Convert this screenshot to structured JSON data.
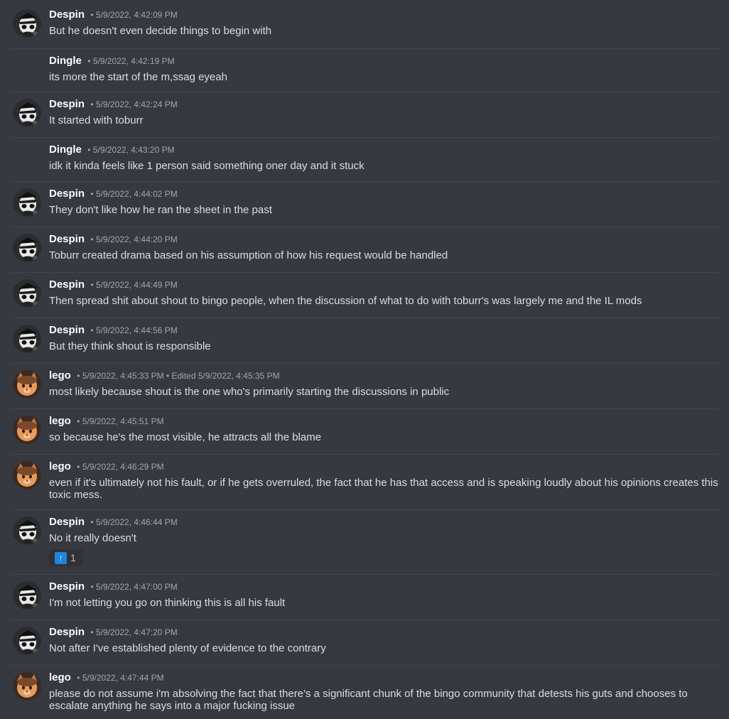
{
  "separator": "•",
  "edited_prefix": "Edited",
  "messages": [
    {
      "author": "Despin",
      "timestamp": "5/9/2022, 4:42:09 PM",
      "text": "But he doesn't even decide things to begin with",
      "avatar": "despin-avatar"
    },
    {
      "author": "Dingle",
      "timestamp": "5/9/2022, 4:42:19 PM",
      "text": "its more the start of the m,ssag eyeah"
    },
    {
      "author": "Despin",
      "timestamp": "5/9/2022, 4:42:24 PM",
      "text": "It started with toburr",
      "avatar": "despin-avatar"
    },
    {
      "author": "Dingle",
      "timestamp": "5/9/2022, 4:43:20 PM",
      "text": "idk it kinda feels like 1 person said something oner day and it stuck"
    },
    {
      "author": "Despin",
      "timestamp": "5/9/2022, 4:44:02 PM",
      "text": "They don't like how he ran the sheet in the past",
      "avatar": "despin-avatar"
    },
    {
      "author": "Despin",
      "timestamp": "5/9/2022, 4:44:20 PM",
      "text": "Toburr created drama based on his assumption of how his request would be handled",
      "avatar": "despin-avatar"
    },
    {
      "author": "Despin",
      "timestamp": "5/9/2022, 4:44:49 PM",
      "text": "Then spread shit about shout to bingo people, when the discussion of what to do with toburr's was largely me and the IL mods",
      "avatar": "despin-avatar"
    },
    {
      "author": "Despin",
      "timestamp": "5/9/2022, 4:44:56 PM",
      "text": "But they think shout is responsible",
      "avatar": "despin-avatar"
    },
    {
      "author": "lego",
      "timestamp": "5/9/2022, 4:45:33 PM",
      "edited": "5/9/2022, 4:45:35 PM",
      "text": "most likely because shout is the one who's primarily starting the discussions in public",
      "avatar": "lego-avatar"
    },
    {
      "author": "lego",
      "timestamp": "5/9/2022, 4:45:51 PM",
      "text": "so because he's the most visible, he attracts all the blame",
      "avatar": "lego-avatar"
    },
    {
      "author": "lego",
      "timestamp": "5/9/2022, 4:46:29 PM",
      "text": "even if it's ultimately not his fault, or if he gets overruled, the fact that he has that access and is speaking loudly about his opinions creates this toxic mess.",
      "avatar": "lego-avatar"
    },
    {
      "author": "Despin",
      "timestamp": "5/9/2022, 4:46:44 PM",
      "text": "No it really doesn't",
      "avatar": "despin-avatar",
      "reaction": {
        "emoji": "↑",
        "icon": "up-arrow-emoji",
        "count": "1"
      }
    },
    {
      "author": "Despin",
      "timestamp": "5/9/2022, 4:47:00 PM",
      "text": "I'm not letting you go on thinking this is all his fault",
      "avatar": "despin-avatar"
    },
    {
      "author": "Despin",
      "timestamp": "5/9/2022, 4:47:20 PM",
      "text": "Not after I've established plenty of evidence to the contrary",
      "avatar": "despin-avatar"
    },
    {
      "author": "lego",
      "timestamp": "5/9/2022, 4:47:44 PM",
      "text": "please do not assume i'm absolving the fact that there's a significant chunk of the bingo community that detests his guts and chooses to escalate anything he says into a major fucking issue",
      "avatar": "lego-avatar"
    }
  ]
}
